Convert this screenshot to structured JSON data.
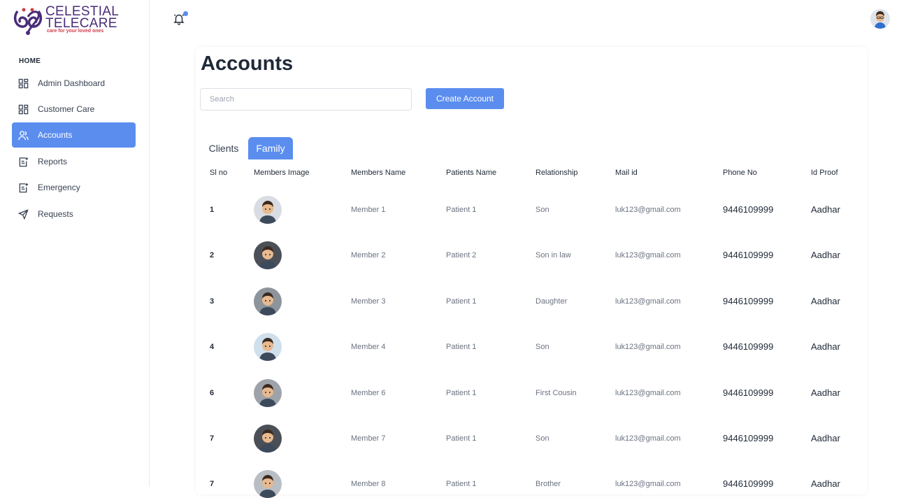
{
  "brand": {
    "name_line1": "CELESTIAL",
    "name_line2": "TELECARE",
    "tagline": "care for your loved ones",
    "accent": "#5b8def"
  },
  "sidebar": {
    "section": "HOME",
    "items": [
      {
        "label": "Admin Dashboard",
        "icon": "dashboard-grid-icon",
        "active": false
      },
      {
        "label": "Customer Care",
        "icon": "dashboard-grid-icon",
        "active": false
      },
      {
        "label": "Accounts",
        "icon": "users-icon",
        "active": true
      },
      {
        "label": "Reports",
        "icon": "report-icon",
        "active": false
      },
      {
        "label": "Emergency",
        "icon": "report-icon",
        "active": false
      },
      {
        "label": "Requests",
        "icon": "send-icon",
        "active": false
      }
    ]
  },
  "topbar": {
    "notification_icon": "bell-icon",
    "avatar_icon": "user-avatar"
  },
  "main": {
    "title": "Accounts",
    "search_placeholder": "Search",
    "create_button": "Create Account",
    "tabs": [
      {
        "label": "Clients",
        "active": false
      },
      {
        "label": "Family",
        "active": true
      }
    ],
    "columns": [
      "Sl no",
      "Members Image",
      "Members Name",
      "Patients Name",
      "Relationship",
      "Mail id",
      "Phone No",
      "Id Proof"
    ],
    "rows": [
      {
        "sl": "1",
        "name": "Member 1",
        "patient": "Patient 1",
        "relation": "Son",
        "mail": "luk123@gmail.com",
        "phone": "9446109999",
        "id": "Aadhar",
        "avatar_bg": "#d9dce2"
      },
      {
        "sl": "2",
        "name": "Member 2",
        "patient": "Patient 2",
        "relation": "Son in law",
        "mail": "luk123@gmail.com",
        "phone": "9446109999",
        "id": "Aadhar",
        "avatar_bg": "#4b4f57"
      },
      {
        "sl": "3",
        "name": "Member 3",
        "patient": "Patient 1",
        "relation": "Daughter",
        "mail": "luk123@gmail.com",
        "phone": "9446109999",
        "id": "Aadhar",
        "avatar_bg": "#8e949c"
      },
      {
        "sl": "4",
        "name": "Member 4",
        "patient": "Patient 1",
        "relation": "Son",
        "mail": "luk123@gmail.com",
        "phone": "9446109999",
        "id": "Aadhar",
        "avatar_bg": "#cfe0ec"
      },
      {
        "sl": "6",
        "name": "Member 6",
        "patient": "Patient 1",
        "relation": "First Cousin",
        "mail": "luk123@gmail.com",
        "phone": "9446109999",
        "id": "Aadhar",
        "avatar_bg": "#9ea3aa"
      },
      {
        "sl": "7",
        "name": "Member 7",
        "patient": "Patient 1",
        "relation": "Son",
        "mail": "luk123@gmail.com",
        "phone": "9446109999",
        "id": "Aadhar",
        "avatar_bg": "#4b4f57"
      },
      {
        "sl": "7",
        "name": "Member 8",
        "patient": "Patient 1",
        "relation": "Brother",
        "mail": "luk123@gmail.com",
        "phone": "9446109999",
        "id": "Aadhar",
        "avatar_bg": "#b9bec5"
      }
    ]
  }
}
